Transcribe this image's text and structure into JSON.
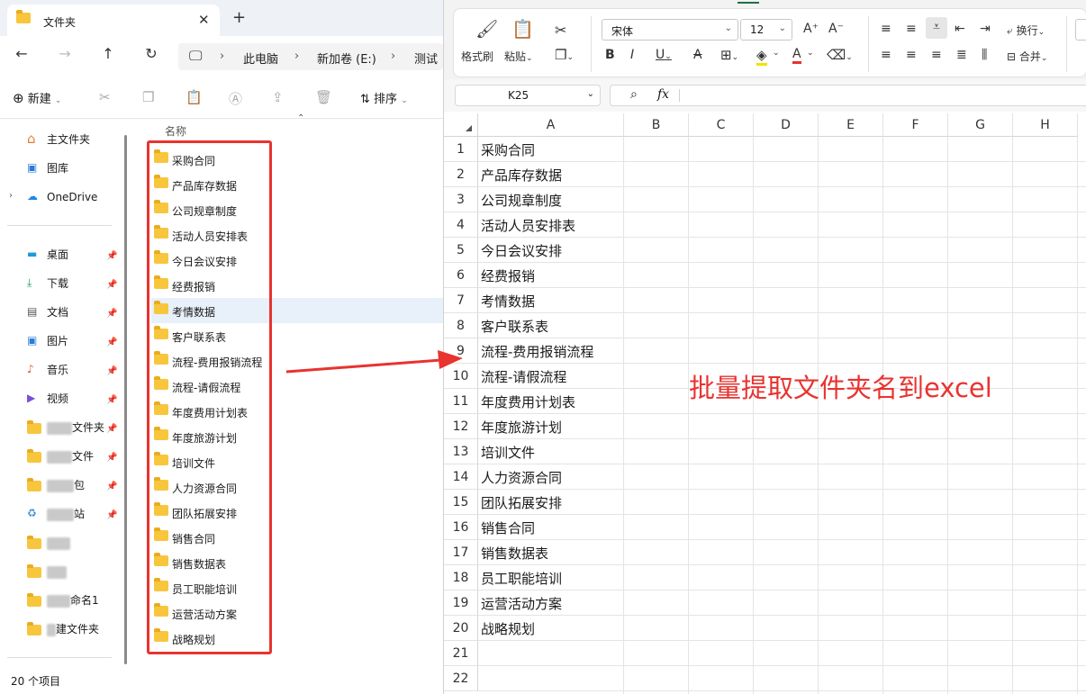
{
  "explorer": {
    "tab": {
      "title": "文件夹"
    },
    "address": {
      "crumbs": [
        "此电脑",
        "新加卷 (E:)",
        "测试"
      ]
    },
    "commands": {
      "new_label": "新建",
      "sort_label": "排序"
    },
    "sidebar": {
      "top": [
        "主文件夹",
        "图库",
        "OneDrive"
      ],
      "pinned": [
        "桌面",
        "下载",
        "文档",
        "图片",
        "音乐",
        "视频"
      ],
      "partial": [
        "文件夹",
        "文件",
        "包",
        "站",
        "",
        "",
        "命名1",
        "建文件夹"
      ]
    },
    "list": {
      "column_name": "名称",
      "items": [
        "采购合同",
        "产品库存数据",
        "公司规章制度",
        "活动人员安排表",
        "今日会议安排",
        "经费报销",
        "考情数据",
        "客户联系表",
        "流程-费用报销流程",
        "流程-请假流程",
        "年度费用计划表",
        "年度旅游计划",
        "培训文件",
        "人力资源合同",
        "团队拓展安排",
        "销售合同",
        "销售数据表",
        "员工职能培训",
        "运营活动方案",
        "战略规划"
      ],
      "selected_index": 6
    },
    "status": "20 个项目"
  },
  "excel": {
    "ribbon": {
      "format_painter": "格式刷",
      "paste": "粘贴",
      "font_name": "宋体",
      "font_size": "12",
      "wrap": "换行",
      "merge": "合并"
    },
    "name_box": "K25",
    "fx_label": "fx",
    "columns": [
      "A",
      "B",
      "C",
      "D",
      "E",
      "F",
      "G",
      "H"
    ],
    "rows": [
      "1",
      "2",
      "3",
      "4",
      "5",
      "6",
      "7",
      "8",
      "9",
      "10",
      "11",
      "12",
      "13",
      "14",
      "15",
      "16",
      "17",
      "18",
      "19",
      "20",
      "21",
      "22"
    ],
    "col_a_values": [
      "采购合同",
      "产品库存数据",
      "公司规章制度",
      "活动人员安排表",
      "今日会议安排",
      "经费报销",
      "考情数据",
      "客户联系表",
      "流程-费用报销流程",
      "流程-请假流程",
      "年度费用计划表",
      "年度旅游计划",
      "培训文件",
      "人力资源合同",
      "团队拓展安排",
      "销售合同",
      "销售数据表",
      "员工职能培训",
      "运营活动方案",
      "战略规划",
      "",
      ""
    ],
    "annotation": "批量提取文件夹名到excel"
  },
  "colors": {
    "highlight": "#e8332f",
    "selection": "#e8f0f9",
    "folder": "#f8c63d"
  }
}
